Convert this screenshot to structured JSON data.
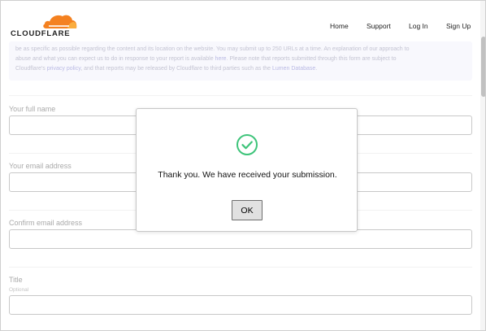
{
  "header": {
    "logo_text": "CLOUDFLARE",
    "nav": {
      "home": "Home",
      "support": "Support",
      "login": "Log In",
      "signup": "Sign Up"
    }
  },
  "notice": {
    "text1": "be as specific as possible regarding the content and its location on the website. You may submit up to 250 URLs at a time. An explanation of our approach to",
    "text2a": "abuse and what you can expect us to do in response to your report is available ",
    "link_here": "here",
    "text2b": ". Please note that reports submitted through this form are subject to",
    "text3a": "Cloudflare's ",
    "link_privacy": "privacy policy",
    "text3b": ", and that reports may be released by Cloudflare to third parties such as the ",
    "link_lumen": "Lumen Database",
    "text3c": "."
  },
  "form": {
    "full_name_label": "Your full name",
    "email_label": "Your email address",
    "confirm_email_label": "Confirm email address",
    "title_label": "Title",
    "title_hint": "Optional"
  },
  "modal": {
    "message": "Thank you. We have received your submission.",
    "ok_label": "OK"
  },
  "colors": {
    "brand_orange": "#f48120",
    "success_green": "#3ec47a"
  },
  "icons": {
    "logo": "cloudflare-cloud-icon",
    "success": "check-circle-icon"
  }
}
